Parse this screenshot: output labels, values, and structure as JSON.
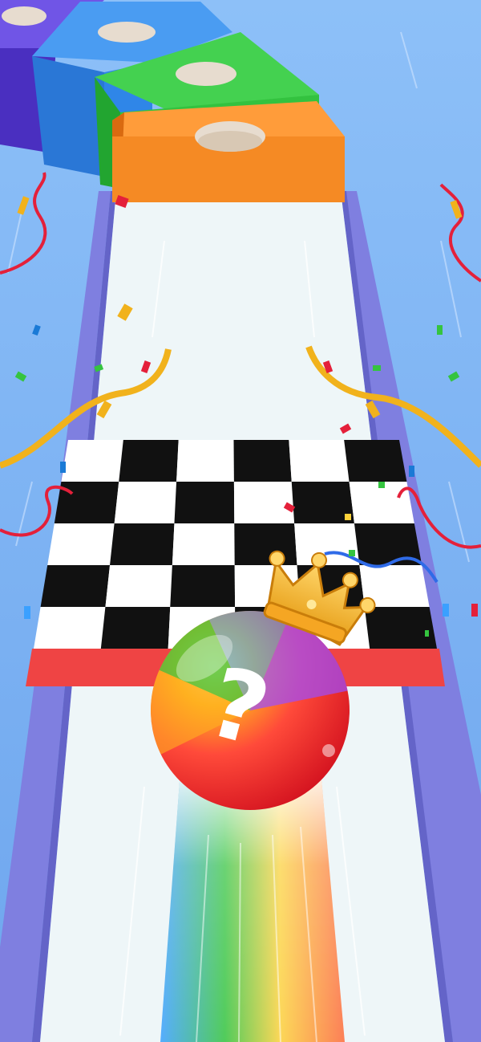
{
  "scene": {
    "sky_color": "#7fb6f5",
    "track_color": "#eef6f8",
    "rail_color": "#7f7fe0",
    "finish_line_color": "#ef4444"
  },
  "goal_boxes": [
    {
      "name": "purple-box",
      "color": "#5b3fd0"
    },
    {
      "name": "blue-box",
      "color": "#2f86e8"
    },
    {
      "name": "green-box",
      "color": "#33c23f"
    },
    {
      "name": "orange-box",
      "color": "#f58a24"
    }
  ],
  "player": {
    "ball_label": "?",
    "crown_icon": "crown-icon",
    "ball_colors": [
      "#ff3b3b",
      "#ffb020",
      "#35c43f",
      "#3aa0ff",
      "#9b4dff"
    ]
  },
  "finish": {
    "checker_colors": [
      "#111111",
      "#ffffff"
    ]
  }
}
